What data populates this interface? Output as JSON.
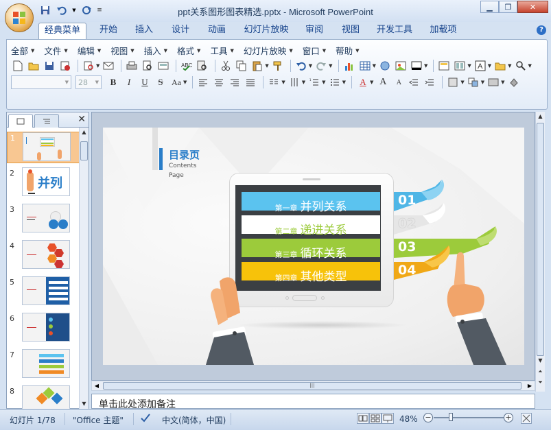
{
  "window": {
    "title": "ppt关系图形图表精选.pptx - Microsoft PowerPoint"
  },
  "ribbon_tabs": [
    "经典菜单",
    "开始",
    "插入",
    "设计",
    "动画",
    "幻灯片放映",
    "审阅",
    "视图",
    "开发工具",
    "加载项"
  ],
  "classic_menu": [
    "全部",
    "文件",
    "编辑",
    "视图",
    "插入",
    "格式",
    "工具",
    "幻灯片放映",
    "窗口",
    "帮助"
  ],
  "font": {
    "name": "",
    "size": "28"
  },
  "thumbs": [
    {
      "num": "1",
      "label": ""
    },
    {
      "num": "2",
      "label": "并列"
    },
    {
      "num": "3",
      "label": ""
    },
    {
      "num": "4",
      "label": ""
    },
    {
      "num": "5",
      "label": ""
    },
    {
      "num": "6",
      "label": ""
    },
    {
      "num": "7",
      "label": ""
    },
    {
      "num": "8",
      "label": ""
    }
  ],
  "slide": {
    "heading": "目录页",
    "sub1": "Contents",
    "sub2": "Page",
    "chapters": [
      {
        "prefix": "第一章",
        "title": "并列关系",
        "num": "01",
        "color": "#5bc3ef"
      },
      {
        "prefix": "第二章",
        "title": "递进关系",
        "num": "02",
        "color": "#f4f4f4"
      },
      {
        "prefix": "第三章",
        "title": "循环关系",
        "num": "03",
        "color": "#9ccb3b"
      },
      {
        "prefix": "第四章",
        "title": "其他类型",
        "num": "04",
        "color": "#f7b718"
      }
    ]
  },
  "notes": "单击此处添加备注",
  "status": {
    "slide": "幻灯片 1/78",
    "theme": "\"Office 主题\"",
    "lang": "中文(简体，中国)",
    "zoom": "48%"
  },
  "colors": {
    "accent": "#2a7ec9",
    "ribbon_text": "#15428b"
  }
}
